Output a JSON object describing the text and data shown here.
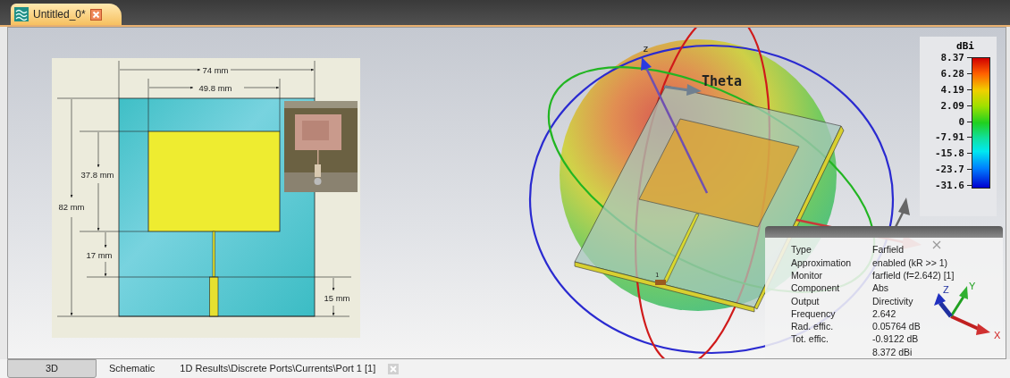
{
  "document_tab": {
    "title": "Untitled_0*",
    "selected": true
  },
  "dimension_drawing": {
    "labels": [
      {
        "kind": "width",
        "text": "74 mm"
      },
      {
        "kind": "patch-width",
        "text": "49.8 mm"
      },
      {
        "kind": "patch-height",
        "text": "37.8 mm"
      },
      {
        "kind": "height",
        "text": "82 mm"
      },
      {
        "kind": "feed-length",
        "text": "17 mm"
      },
      {
        "kind": "ground-length",
        "text": "15 mm"
      }
    ]
  },
  "plot": {
    "z_label": "z",
    "theta_label": "Theta",
    "port_label": "1"
  },
  "legend": {
    "unit": "dBi",
    "ticks": [
      "8.37",
      "6.28",
      "4.19",
      "2.09",
      "0",
      "-7.91",
      "-15.8",
      "-23.7",
      "-31.6"
    ]
  },
  "info_panel": {
    "rows": [
      {
        "label": "Type",
        "value": "Farfield"
      },
      {
        "label": "Approximation",
        "value": "enabled (kR >> 1)"
      },
      {
        "label": "Monitor",
        "value": "farfield (f=2.642) [1]"
      },
      {
        "label": "Component",
        "value": "Abs"
      },
      {
        "label": "Output",
        "value": "Directivity"
      },
      {
        "label": "Frequency",
        "value": "2.642"
      },
      {
        "label": "Rad. effic.",
        "value": "0.05764 dB"
      },
      {
        "label": "Tot. effic.",
        "value": "-0.9122 dB"
      },
      {
        "value": "8.372 dBi"
      }
    ],
    "axes": {
      "x": "X",
      "y": "Y",
      "z": "Z"
    }
  },
  "bottom_tabs": [
    {
      "label": "3D",
      "selected": true,
      "closable": false
    },
    {
      "label": "Schematic",
      "selected": false,
      "closable": false
    },
    {
      "label": "1D Results\\Discrete Ports\\Currents\\Port 1 [1]",
      "selected": false,
      "closable": true
    }
  ]
}
